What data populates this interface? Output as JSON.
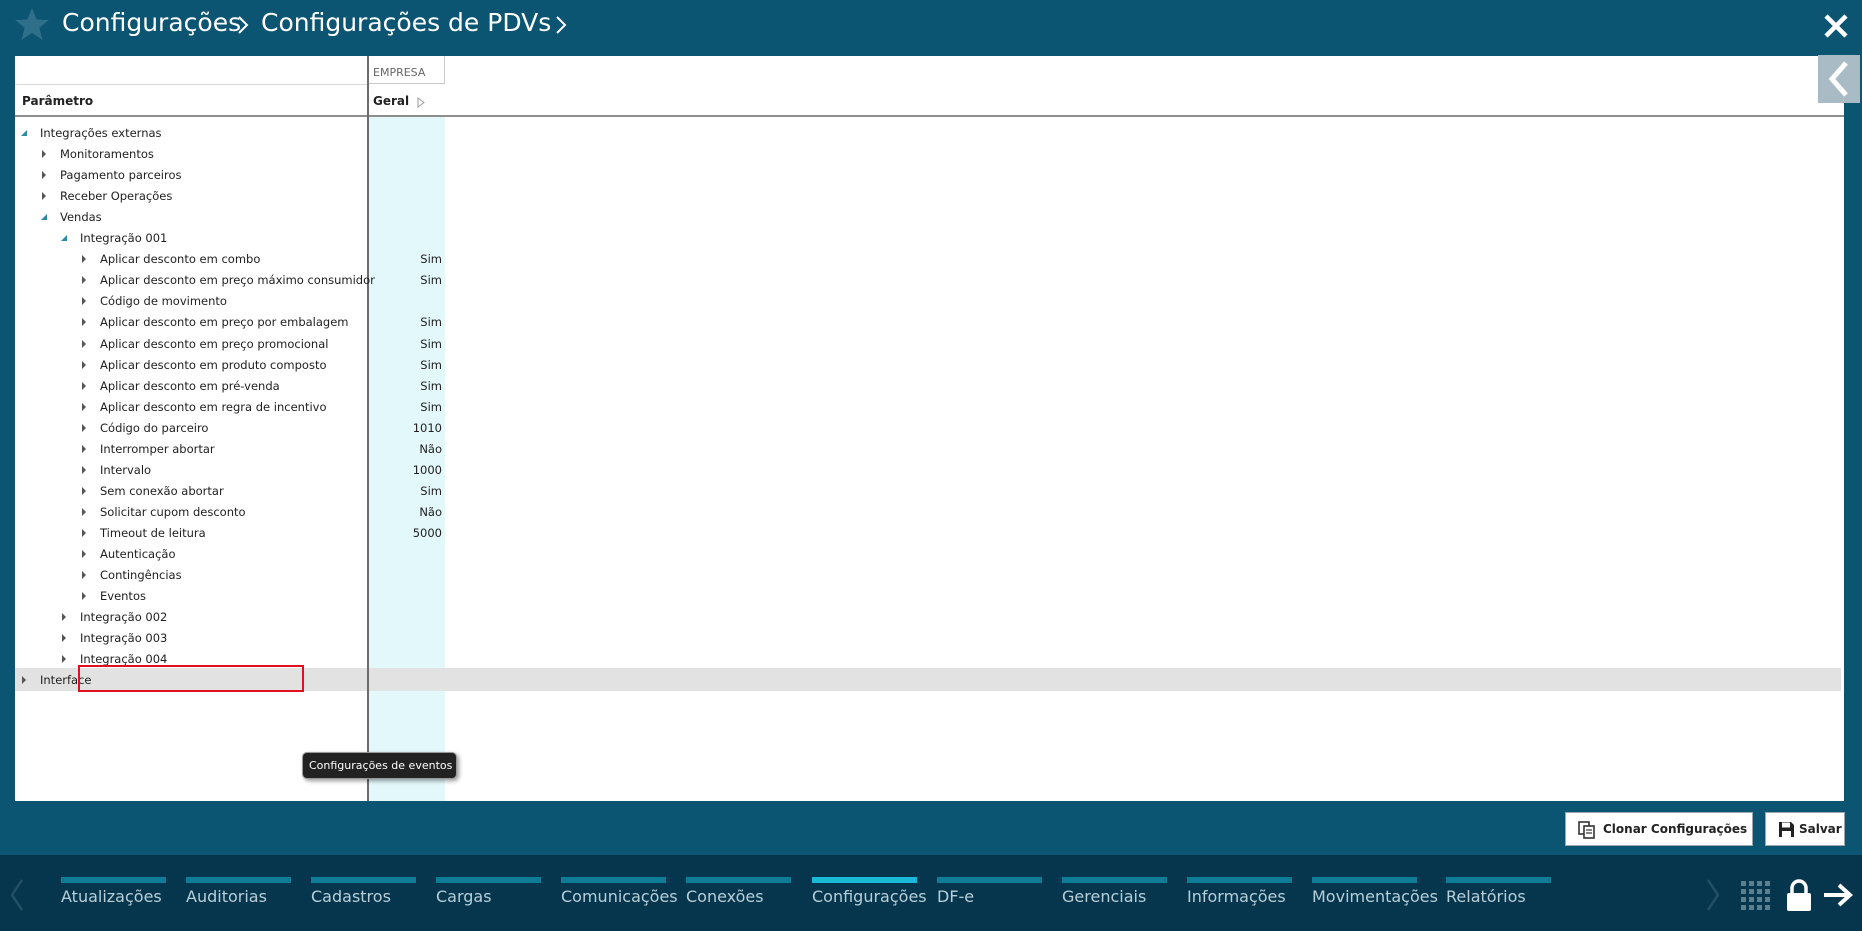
{
  "header": {
    "breadcrumb": [
      "Configurações",
      "Configurações de PDVs"
    ]
  },
  "grid": {
    "column_group": "EMPRESA",
    "param_header": "Parâmetro",
    "value_header": "Geral",
    "rows": [
      {
        "label": "Integrações externas",
        "value": "",
        "expanded": true
      },
      {
        "label": "Monitoramentos",
        "value": "",
        "expanded": false
      },
      {
        "label": "Pagamento parceiros",
        "value": "",
        "expanded": false
      },
      {
        "label": "Receber Operações",
        "value": "",
        "expanded": false
      },
      {
        "label": "Vendas",
        "value": "",
        "expanded": true
      },
      {
        "label": "Integração 001",
        "value": "",
        "expanded": true
      },
      {
        "label": "Aplicar desconto em combo",
        "value": "Sim",
        "expanded": false
      },
      {
        "label": "Aplicar desconto em preço máximo consumidor",
        "value": "Sim",
        "expanded": false
      },
      {
        "label": "Código de movimento",
        "value": "",
        "expanded": false
      },
      {
        "label": "Aplicar desconto em preço por embalagem",
        "value": "Sim",
        "expanded": false
      },
      {
        "label": "Aplicar desconto em preço promocional",
        "value": "Sim",
        "expanded": false
      },
      {
        "label": "Aplicar desconto em produto composto",
        "value": "Sim",
        "expanded": false
      },
      {
        "label": "Aplicar desconto em pré-venda",
        "value": "Sim",
        "expanded": false
      },
      {
        "label": "Aplicar desconto em regra de incentivo",
        "value": "Sim",
        "expanded": false
      },
      {
        "label": "Código do parceiro",
        "value": "1010",
        "expanded": false
      },
      {
        "label": "Interromper abortar",
        "value": "Não",
        "expanded": false
      },
      {
        "label": "Intervalo",
        "value": "1000",
        "expanded": false
      },
      {
        "label": "Sem conexão abortar",
        "value": "Sim",
        "expanded": false
      },
      {
        "label": "Solicitar cupom desconto",
        "value": "Não",
        "expanded": false
      },
      {
        "label": "Timeout de leitura",
        "value": "5000",
        "expanded": false
      },
      {
        "label": "Autenticação",
        "value": "",
        "expanded": false
      },
      {
        "label": "Contingências",
        "value": "",
        "expanded": false
      },
      {
        "label": "Eventos",
        "value": "",
        "expanded": false,
        "selected": true
      },
      {
        "label": "Integração 002",
        "value": "",
        "expanded": false
      },
      {
        "label": "Integração 003",
        "value": "",
        "expanded": false
      },
      {
        "label": "Integração 004",
        "value": "",
        "expanded": false
      },
      {
        "label": "Interface",
        "value": "",
        "expanded": false
      }
    ],
    "tooltip": "Configurações de eventos"
  },
  "actions": {
    "clone_label": "Clonar Configurações",
    "save_label": "Salvar"
  },
  "bottom_nav": {
    "items": [
      "Atualizações",
      "Auditorias",
      "Cadastros",
      "Cargas",
      "Comunicações",
      "Conexões",
      "Configurações",
      "DF-e",
      "Gerenciais",
      "Informações",
      "Movimentações",
      "Relatórios"
    ],
    "active": "Configurações"
  },
  "colors": {
    "header_bg": "#0b5572",
    "nav_bg": "#05364e",
    "nav_bar": "#0e7c96",
    "nav_bar_active": "#19b9d7",
    "value_column_bg": "#e3f8fb",
    "selection_border": "#e0101e"
  }
}
